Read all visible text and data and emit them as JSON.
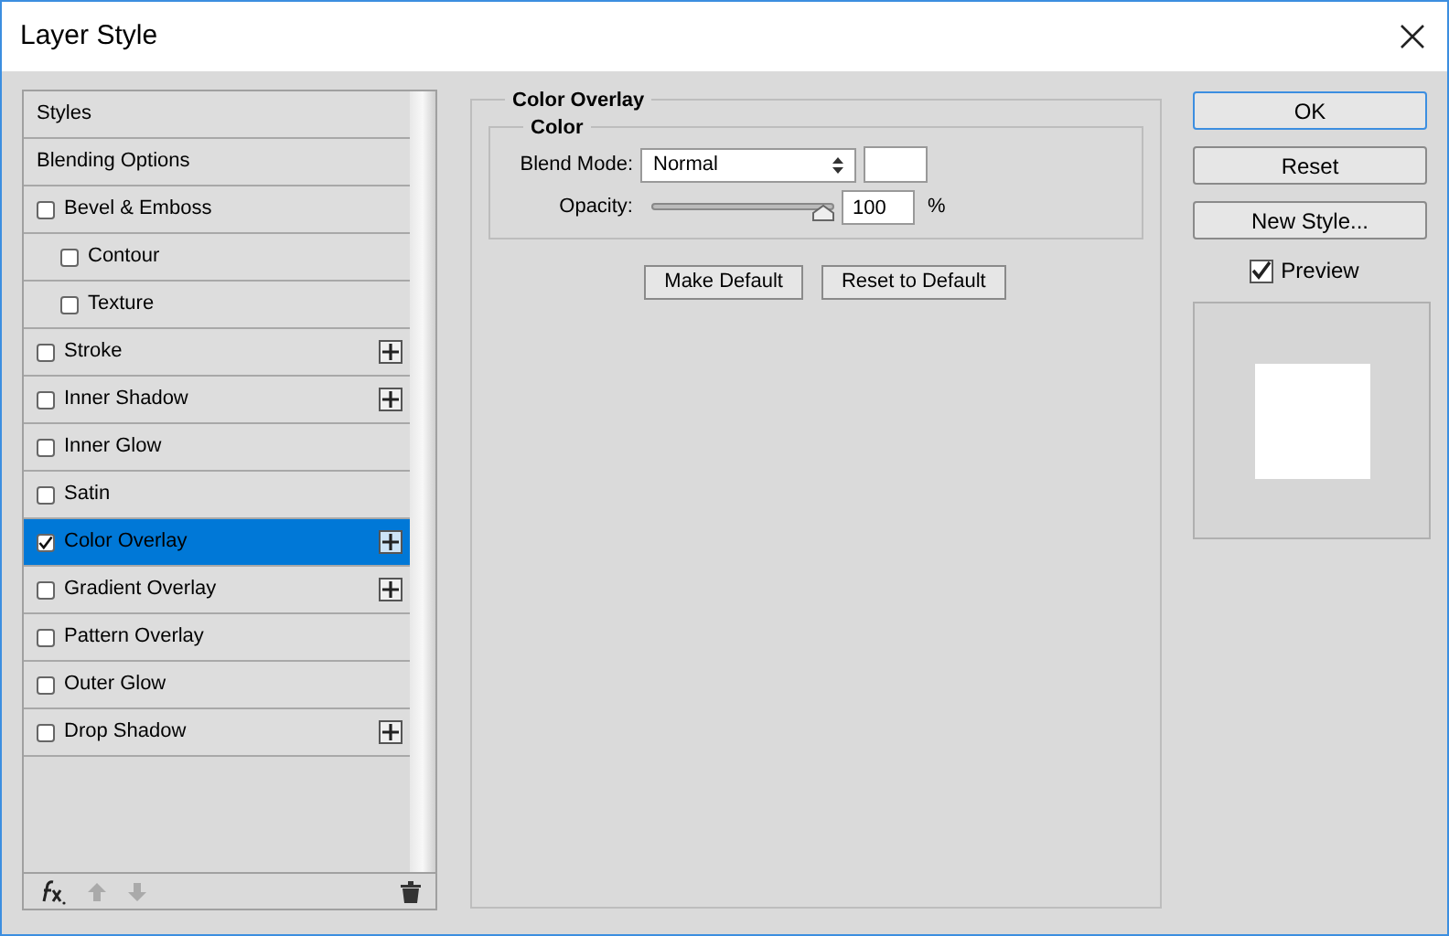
{
  "window": {
    "title": "Layer Style"
  },
  "styles_list": [
    {
      "kind": "header",
      "label": "Styles",
      "selected": false
    },
    {
      "kind": "header",
      "label": "Blending Options",
      "selected": false
    },
    {
      "kind": "effect",
      "label": "Bevel & Emboss",
      "checked": false,
      "selected": false,
      "add_button": false,
      "children": [
        {
          "kind": "effect",
          "label": "Contour",
          "checked": false,
          "selected": false,
          "add_button": false
        },
        {
          "kind": "effect",
          "label": "Texture",
          "checked": false,
          "selected": false,
          "add_button": false
        }
      ]
    },
    {
      "kind": "effect",
      "label": "Stroke",
      "checked": false,
      "selected": false,
      "add_button": true
    },
    {
      "kind": "effect",
      "label": "Inner Shadow",
      "checked": false,
      "selected": false,
      "add_button": true
    },
    {
      "kind": "effect",
      "label": "Inner Glow",
      "checked": false,
      "selected": false,
      "add_button": false
    },
    {
      "kind": "effect",
      "label": "Satin",
      "checked": false,
      "selected": false,
      "add_button": false
    },
    {
      "kind": "effect",
      "label": "Color Overlay",
      "checked": true,
      "selected": true,
      "add_button": true
    },
    {
      "kind": "effect",
      "label": "Gradient Overlay",
      "checked": false,
      "selected": false,
      "add_button": true
    },
    {
      "kind": "effect",
      "label": "Pattern Overlay",
      "checked": false,
      "selected": false,
      "add_button": false
    },
    {
      "kind": "effect",
      "label": "Outer Glow",
      "checked": false,
      "selected": false,
      "add_button": false
    },
    {
      "kind": "effect",
      "label": "Drop Shadow",
      "checked": false,
      "selected": false,
      "add_button": true
    }
  ],
  "panel": {
    "title": "Color Overlay",
    "group_title": "Color",
    "blend_mode": {
      "label": "Blend Mode:",
      "value": "Normal",
      "color": "#ffffff"
    },
    "opacity": {
      "label": "Opacity:",
      "level": 1,
      "value": "100",
      "unit": "%"
    },
    "buttons": [
      "Make Default",
      "Reset to Default"
    ]
  },
  "buttons": [
    "OK",
    "Reset",
    "New Style..."
  ],
  "preview": {
    "label": "Preview",
    "checked": true
  }
}
